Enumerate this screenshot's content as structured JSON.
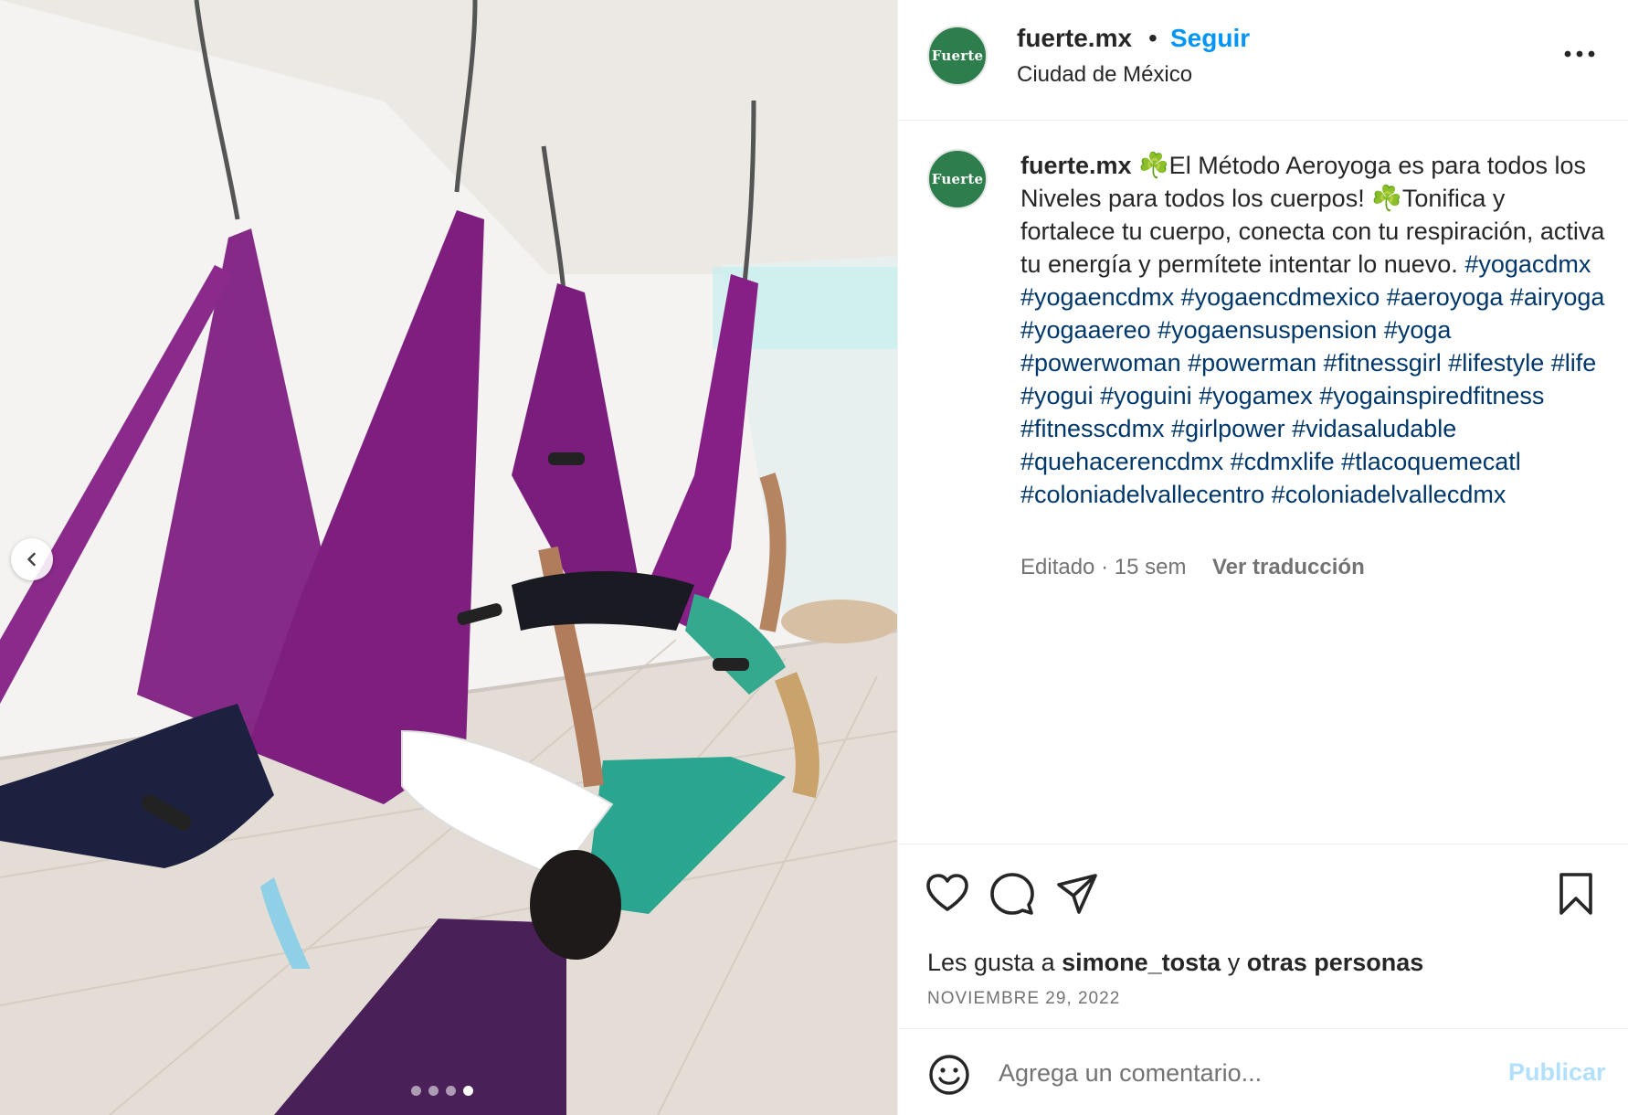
{
  "post": {
    "media": {
      "alt": "",
      "slide_count": 4,
      "active_slide": 4,
      "prev_icon": "chevron-left-icon"
    },
    "header": {
      "avatar_text": "Fuerte",
      "username": "fuerte.mx",
      "separator": "•",
      "follow_label": "Seguir",
      "location": "Ciudad de México",
      "more_icon": "more-horizontal-icon"
    },
    "caption": {
      "username": "fuerte.mx",
      "text": "☘️El Método Aeroyoga es para todos los Niveles para todos los cuerpos! ☘️Tonifica y fortalece tu cuerpo, conecta con tu respiración, activa tu energía y permítete intentar lo nuevo.",
      "hashtags": "#yogacdmx #yogaencdmx #yogaencdmexico #aeroyoga #airyoga #yogaaereo #yogaensuspension #yoga #powerwoman #powerman #fitnessgirl #lifestyle #life #yogui #yoguini #yogamex #yogainspiredfitness #fitnesscdmx #girlpower #vidasaludable #quehacerencdmx #cdmxlife #tlacoquemecatl #coloniadelvallecentro #coloniadelvallecdmx",
      "meta": "Editado · 15 sem",
      "translate_label": "Ver traducción"
    },
    "actions": {
      "like_icon": "heart-icon",
      "comment_icon": "comment-icon",
      "share_icon": "send-icon",
      "save_icon": "bookmark-icon"
    },
    "likes": {
      "prefix": "Les gusta a",
      "user": "simone_tosta",
      "conj": "y",
      "others": "otras personas"
    },
    "date": "NOVIEMBRE 29, 2022",
    "comment": {
      "emoji_icon": "emoji-icon",
      "placeholder": "Agrega un comentario...",
      "publish_label": "Publicar"
    },
    "colors": {
      "accent": "#0095f6",
      "hashtag": "#00376b",
      "publish_disabled": "#b2dffc",
      "avatar_bg": "#2e7d4c",
      "hammock": "#7e1f7f"
    }
  }
}
